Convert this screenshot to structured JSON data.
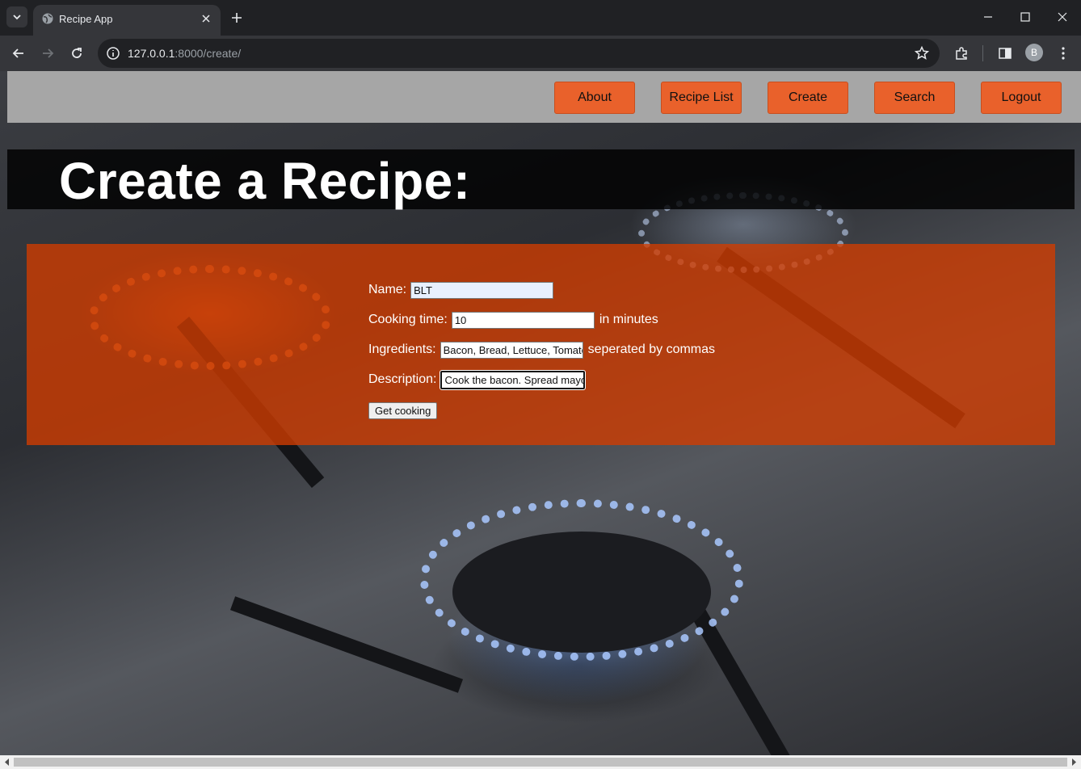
{
  "browser": {
    "tab_title": "Recipe App",
    "url_host": "127.0.0.1",
    "url_rest": ":8000/create/",
    "profile_initial": "B"
  },
  "nav": {
    "items": [
      "About",
      "Recipe List",
      "Create",
      "Search",
      "Logout"
    ]
  },
  "page": {
    "title": "Create a Recipe:"
  },
  "form": {
    "name_label": "Name:",
    "name_value": "BLT",
    "cooking_time_label": "Cooking time:",
    "cooking_time_value": "10",
    "cooking_time_hint": "in minutes",
    "ingredients_label": "Ingredients:",
    "ingredients_value": "Bacon, Bread, Lettuce, Tomato",
    "ingredients_hint": "seperated by commas",
    "description_label": "Description:",
    "description_value": "Cook the bacon. Spread mayo",
    "submit_label": "Get cooking"
  },
  "colors": {
    "accent": "#e9612b",
    "header_bg": "#a6a6a6",
    "panel": "#d23c00"
  }
}
